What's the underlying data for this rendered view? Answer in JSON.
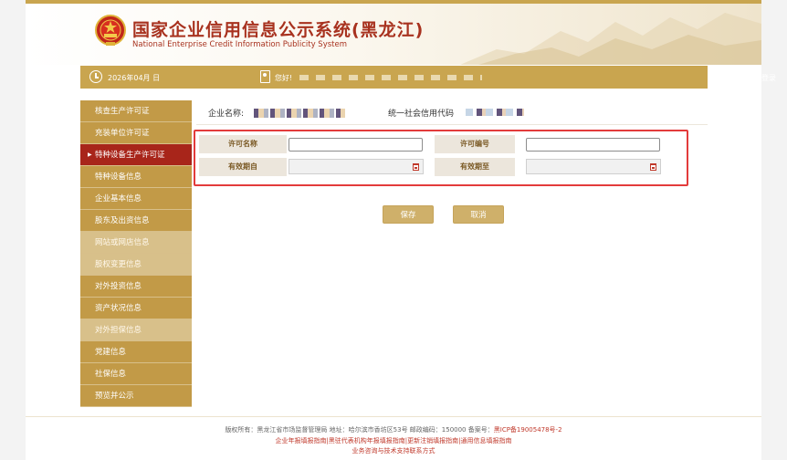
{
  "header": {
    "title": "国家企业信用信息公示系统(黑龙江)",
    "subtitle": "National Enterprise Credit Information Publicity System"
  },
  "userbar": {
    "date": "2026年04月      日",
    "greeting": "您好!",
    "logout": "退出登录"
  },
  "sidebar": {
    "items": [
      {
        "label": "核查生产许可证",
        "style": "normal"
      },
      {
        "label": "充装单位许可证",
        "style": "normal"
      },
      {
        "label": "特种设备生产许可证",
        "style": "active"
      },
      {
        "label": "特种设备信息",
        "style": "normal"
      },
      {
        "label": "企业基本信息",
        "style": "normal"
      },
      {
        "label": "股东及出资信息",
        "style": "normal"
      },
      {
        "label": "网站或网店信息",
        "style": "light"
      },
      {
        "label": "股权变更信息",
        "style": "light"
      },
      {
        "label": "对外投资信息",
        "style": "normal"
      },
      {
        "label": "资产状况信息",
        "style": "normal"
      },
      {
        "label": "对外担保信息",
        "style": "light"
      },
      {
        "label": "党建信息",
        "style": "normal"
      },
      {
        "label": "社保信息",
        "style": "normal"
      },
      {
        "label": "预览并公示",
        "style": "normal"
      }
    ]
  },
  "company": {
    "name_label": "企业名称:",
    "credit_label": "统一社会信用代码"
  },
  "form": {
    "license_name_label": "许可名称",
    "license_name_value": "",
    "license_no_label": "许可编号",
    "license_no_value": "",
    "valid_from_label": "有效期自",
    "valid_from_value": "",
    "valid_to_label": "有效期至",
    "valid_to_value": ""
  },
  "buttons": {
    "save": "保存",
    "cancel": "取消"
  },
  "footer": {
    "line1_prefix": "版权所有：黑龙江省市场监督管理局 地址：哈尔滨市香坊区53号 邮政编码：150000 备案号：",
    "icp": "黑ICP备19005478号-2",
    "line2": "企业年报填报指南|黑驻代表机构年报填报指南|更新注销填报指南|通用信息填报指南",
    "line3": "业务咨询与技术支持联系方式"
  },
  "colors": {
    "gold": "#c9a54f",
    "active_red": "#a8251a",
    "highlight_border": "#e33b3b",
    "title_red": "#a8321f"
  }
}
